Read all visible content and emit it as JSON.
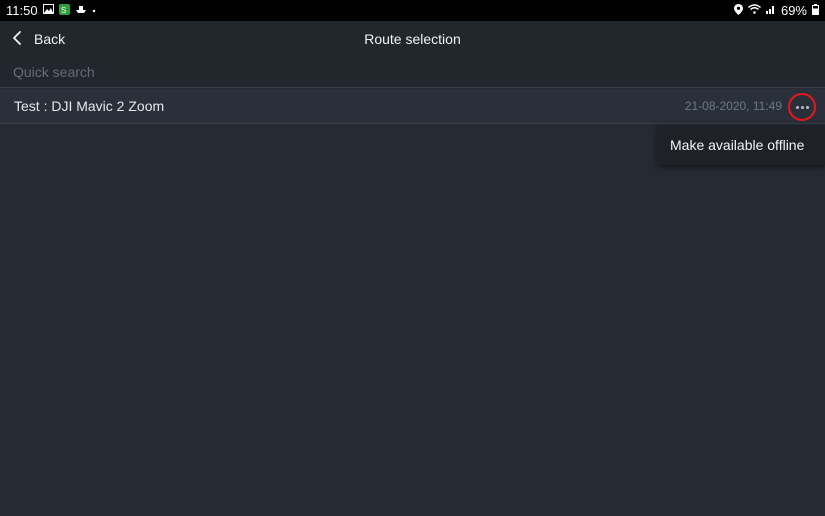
{
  "status_bar": {
    "time": "11:50",
    "battery": "69%",
    "icons_left": [
      "gallery-icon",
      "app-notification-icon",
      "boat-icon",
      "dot-icon"
    ],
    "icons_right": [
      "location-icon",
      "wifi-icon",
      "signal-icon",
      "battery-icon"
    ]
  },
  "header": {
    "back_label": "Back",
    "title": "Route selection"
  },
  "search": {
    "placeholder": "Quick search",
    "value": ""
  },
  "routes": [
    {
      "name": "Test : DJI Mavic 2 Zoom",
      "date": "21-08-2020, 11:49"
    }
  ],
  "context_menu": {
    "items": [
      "Make available offline"
    ]
  },
  "colors": {
    "background": "#262b33",
    "header": "#22272e",
    "highlight_ring": "#e8161c"
  }
}
